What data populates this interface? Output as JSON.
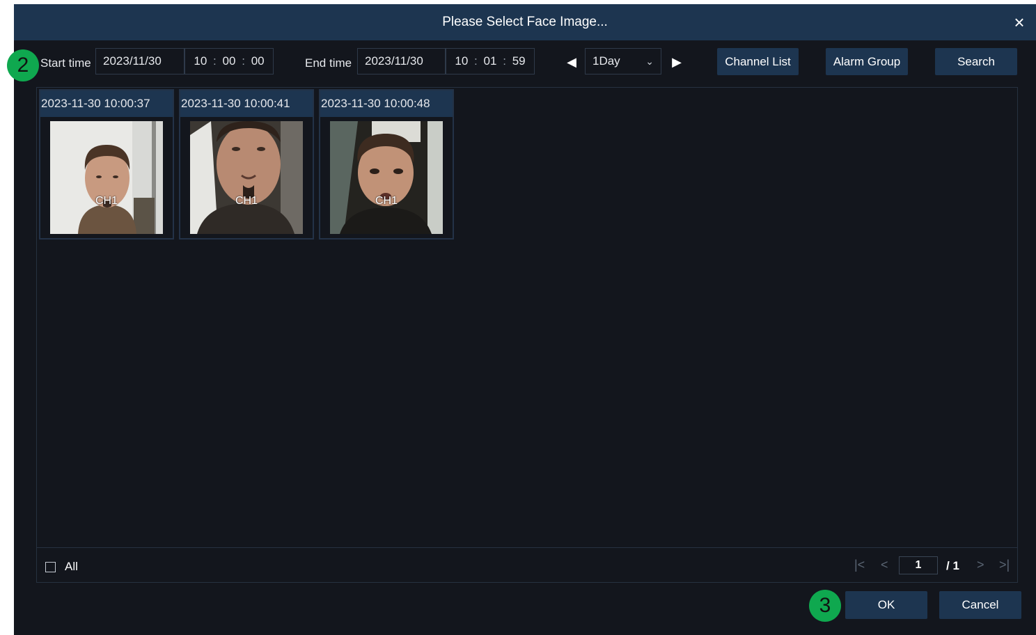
{
  "dialog": {
    "title": "Please Select Face Image...",
    "close": "×"
  },
  "toolbar": {
    "start_label": "Start time",
    "start_date": "2023/11/30",
    "start_time": {
      "h": "10",
      "m": "00",
      "s": "00"
    },
    "end_label": "End time",
    "end_date": "2023/11/30",
    "end_time": {
      "h": "10",
      "m": "01",
      "s": "59"
    },
    "time_sep": ":",
    "range_value": "1Day",
    "prev_arrow": "◀",
    "next_arrow": "▶",
    "channel_list": "Channel List",
    "alarm_group": "Alarm Group",
    "search": "Search"
  },
  "cards": [
    {
      "timestamp": "2023-11-30 10:00:37",
      "channel": "CH1"
    },
    {
      "timestamp": "2023-11-30 10:00:41",
      "channel": "CH1"
    },
    {
      "timestamp": "2023-11-30 10:00:48",
      "channel": "CH1"
    }
  ],
  "footer": {
    "all_label": "All",
    "first": "|<",
    "prev": "<",
    "page": "1",
    "total": "/ 1",
    "next": ">",
    "last": ">|"
  },
  "buttons": {
    "ok": "OK",
    "cancel": "Cancel"
  },
  "markers": [
    "2",
    "3"
  ],
  "colors": {
    "accent": "#1d3550",
    "background": "#13161d",
    "marker": "#0fa84f"
  }
}
